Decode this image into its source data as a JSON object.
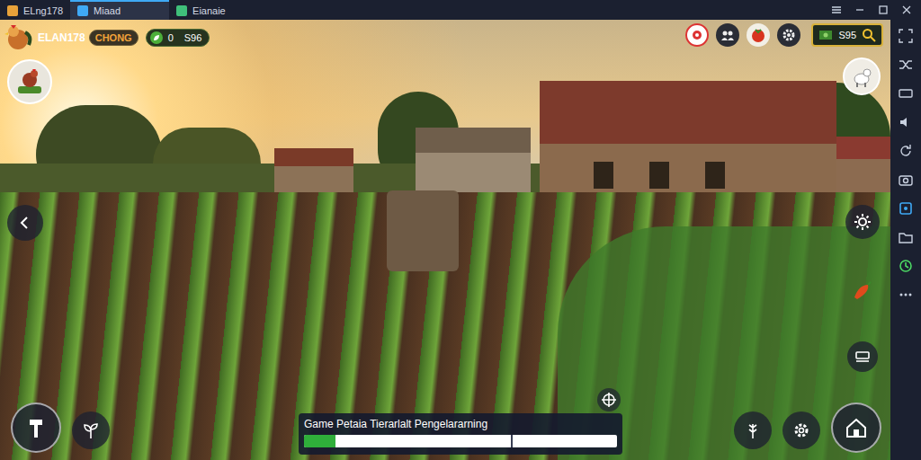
{
  "window": {
    "tabs": [
      {
        "label": "ELng178",
        "selected": false
      },
      {
        "label": "Miaad",
        "selected": true
      },
      {
        "label": "Eianaie",
        "selected": false
      }
    ]
  },
  "hud": {
    "player": "ELAN178",
    "rank": "CHONG",
    "counter": "0",
    "coins": "S96",
    "money": "S95"
  },
  "progress": {
    "label": "Game Petaia Tierarlalt Pengelararning",
    "level": 0.1
  }
}
